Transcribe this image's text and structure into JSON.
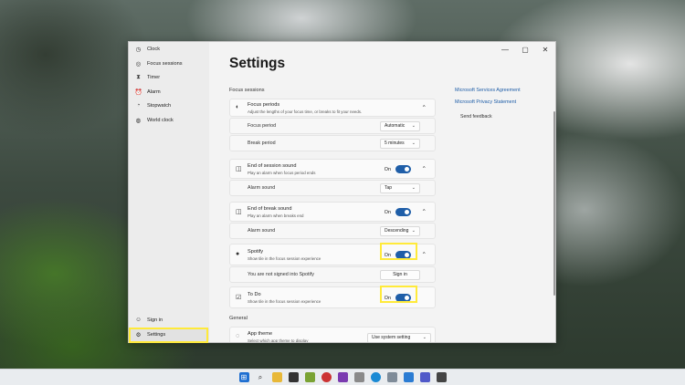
{
  "window": {
    "controls": {
      "minimize": "—",
      "maximize": "▢",
      "close": "✕"
    }
  },
  "sidebar": {
    "items": [
      {
        "label": "Clock",
        "icon": "clock-icon"
      },
      {
        "label": "Focus sessions",
        "icon": "focus-icon"
      },
      {
        "label": "Timer",
        "icon": "timer-icon"
      },
      {
        "label": "Alarm",
        "icon": "alarm-icon"
      },
      {
        "label": "Stopwatch",
        "icon": "stopwatch-icon"
      },
      {
        "label": "World clock",
        "icon": "globe-icon"
      }
    ],
    "sign_in": "Sign in",
    "settings": "Settings"
  },
  "main": {
    "title": "Settings",
    "focus_section": "Focus sessions",
    "focus_periods": {
      "title": "Focus periods",
      "subtitle": "Adjust the lengths of your focus time, or breaks to fit your needs.",
      "focus_period_label": "Focus period",
      "focus_period_value": "Automatic",
      "break_period_label": "Break period",
      "break_period_value": "5 minutes"
    },
    "end_session": {
      "title": "End of session sound",
      "subtitle": "Play an alarm when focus period ends",
      "toggle": "On",
      "alarm_label": "Alarm sound",
      "alarm_value": "Tap"
    },
    "end_break": {
      "title": "End of break sound",
      "subtitle": "Play an alarm when breaks end",
      "toggle": "On",
      "alarm_label": "Alarm sound",
      "alarm_value": "Descending"
    },
    "spotify": {
      "title": "Spotify",
      "subtitle": "Show tile in the focus session experience",
      "toggle": "On",
      "not_signed": "You are not signed into Spotify",
      "sign_in": "Sign in"
    },
    "todo": {
      "title": "To Do",
      "subtitle": "Show tile in the focus session experience",
      "toggle": "On"
    },
    "general_section": "General",
    "app_theme": {
      "title": "App theme",
      "subtitle": "Select which app theme to display",
      "value": "Use system setting"
    }
  },
  "links": {
    "services": "Microsoft Services Agreement",
    "privacy": "Microsoft Privacy Statement",
    "feedback": "Send feedback"
  },
  "colors": {
    "accent": "#1f5ea8",
    "highlight": "#ffea3a"
  }
}
